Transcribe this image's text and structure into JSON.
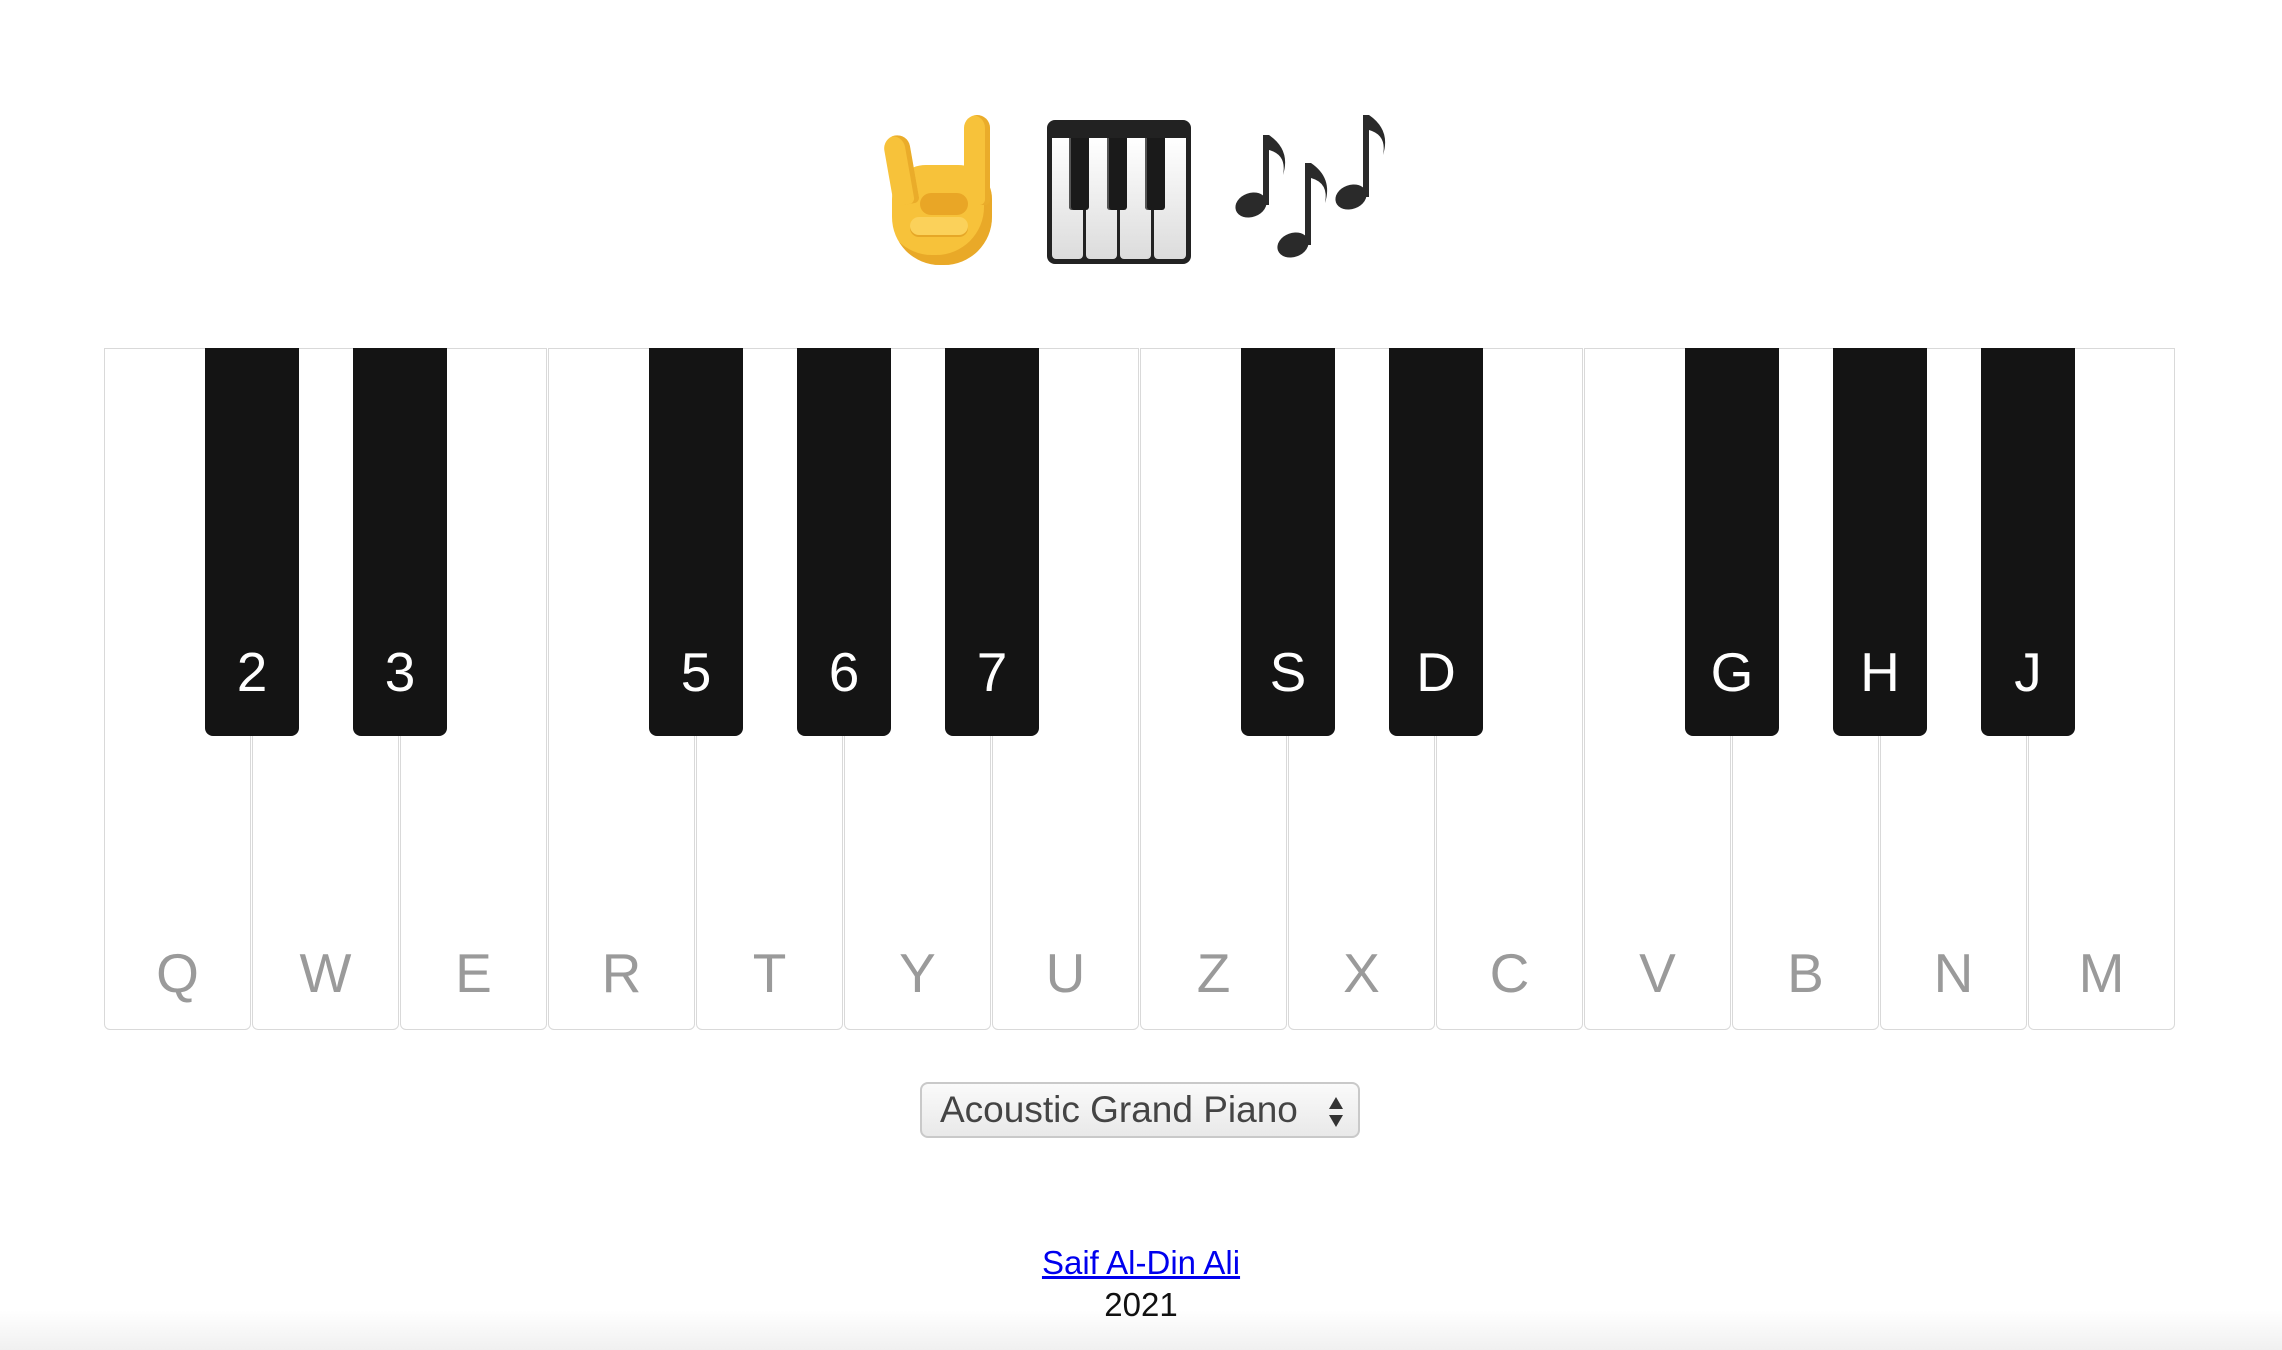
{
  "header": {
    "icons": [
      "rock-hand-emoji",
      "musical-keyboard-emoji",
      "musical-notes-emoji"
    ]
  },
  "keyboard": {
    "white_keys": [
      {
        "label": "Q"
      },
      {
        "label": "W"
      },
      {
        "label": "E"
      },
      {
        "label": "R"
      },
      {
        "label": "T"
      },
      {
        "label": "Y"
      },
      {
        "label": "U"
      },
      {
        "label": "Z"
      },
      {
        "label": "X"
      },
      {
        "label": "C"
      },
      {
        "label": "V"
      },
      {
        "label": "B"
      },
      {
        "label": "N"
      },
      {
        "label": "M"
      }
    ],
    "black_keys": [
      {
        "label": "2"
      },
      {
        "label": "3"
      },
      {
        "label": "5"
      },
      {
        "label": "6"
      },
      {
        "label": "7"
      },
      {
        "label": "S"
      },
      {
        "label": "D"
      },
      {
        "label": "G"
      },
      {
        "label": "H"
      },
      {
        "label": "J"
      }
    ],
    "colors": {
      "white_key": "#ffffff",
      "black_key": "#141414",
      "white_label": "#9a9a9a",
      "black_label": "#ffffff"
    }
  },
  "instrument_select": {
    "selected": "Acoustic Grand Piano"
  },
  "footer": {
    "author": "Saif Al-Din Ali",
    "year": "2021",
    "link_color": "#0000ee"
  }
}
